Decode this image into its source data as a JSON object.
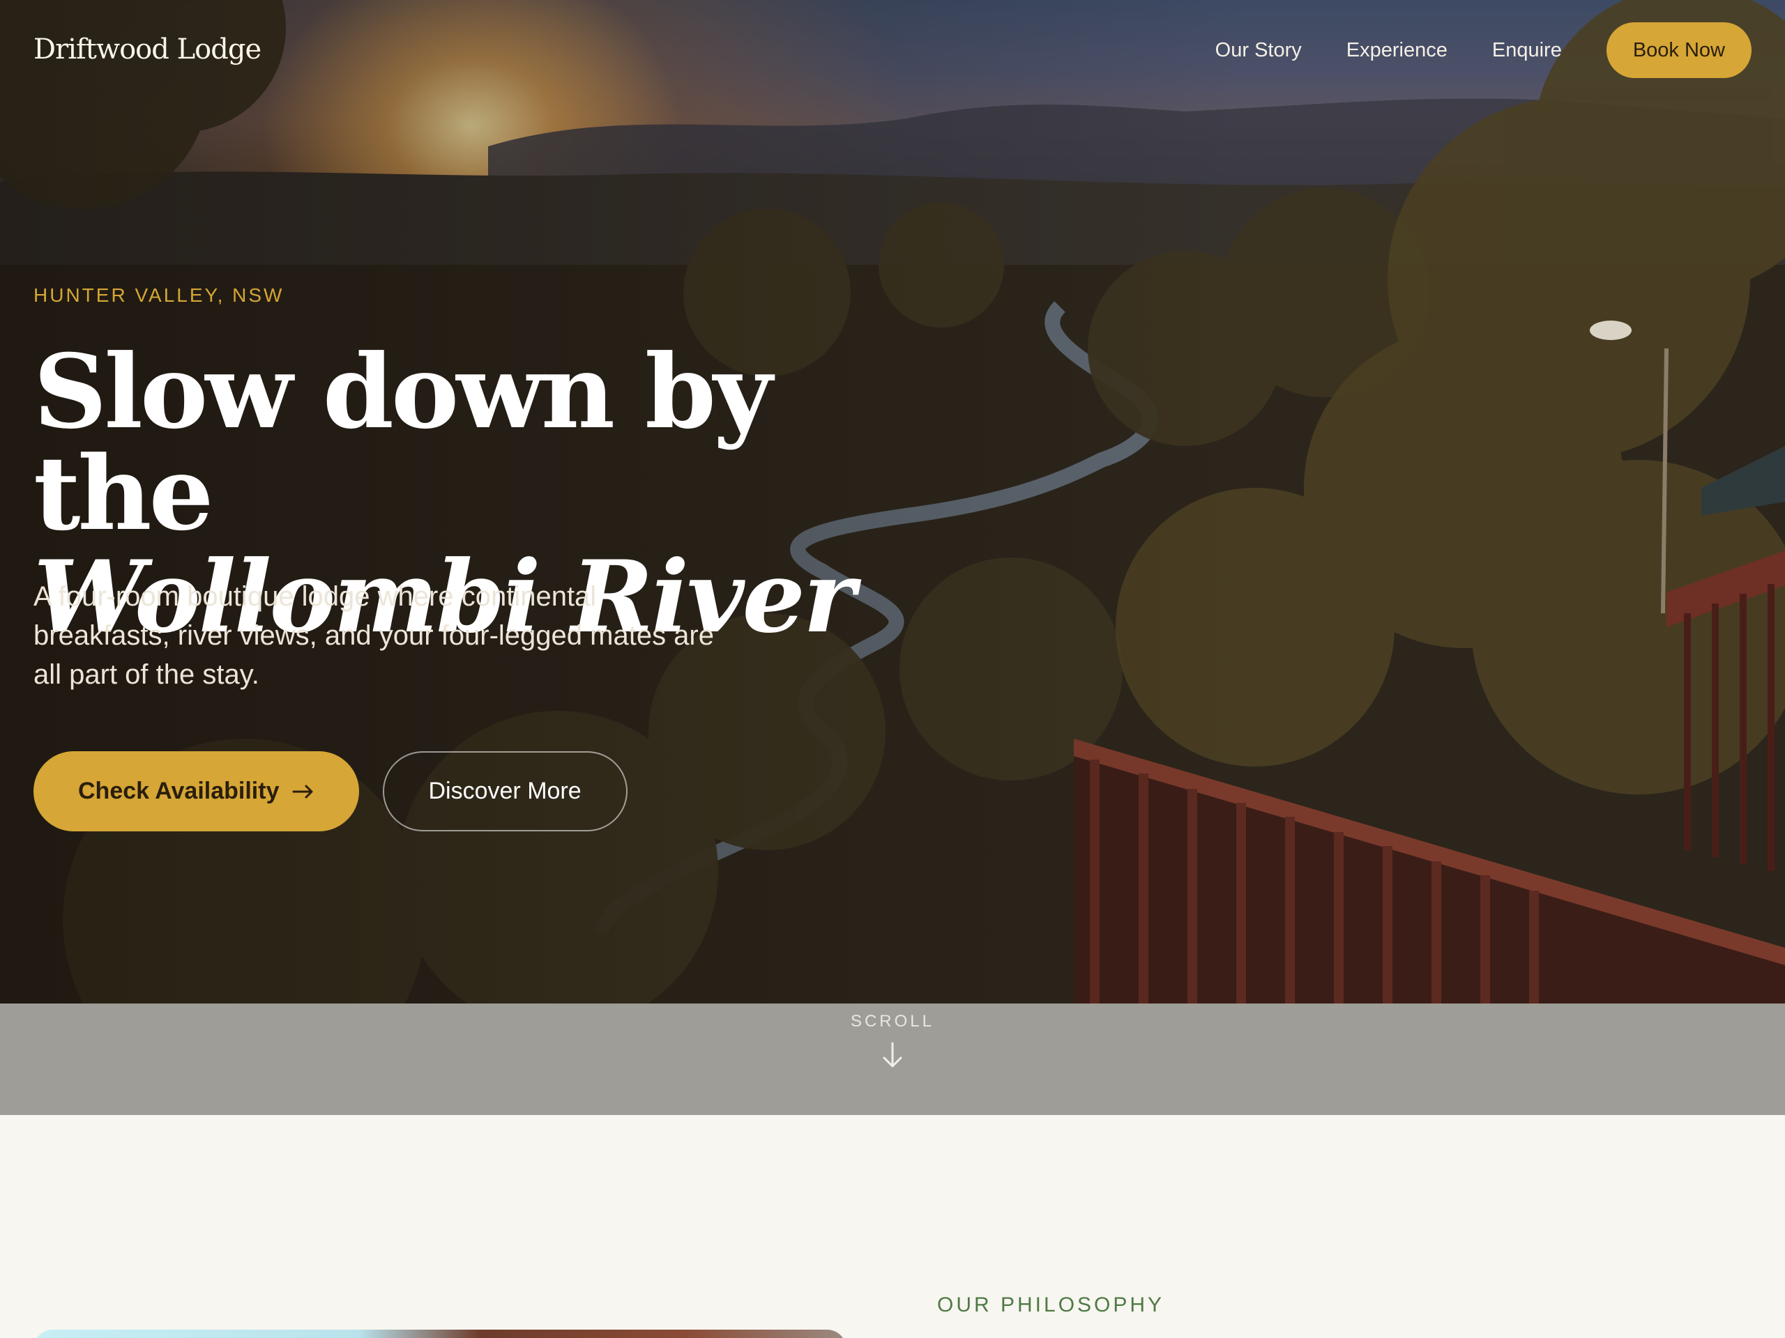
{
  "header": {
    "brand": "Driftwood Lodge",
    "nav": [
      "Our Story",
      "Experience",
      "Enquire"
    ],
    "book_label": "Book Now"
  },
  "hero": {
    "eyebrow": "HUNTER VALLEY, NSW",
    "headline_line1": "Slow down by the",
    "headline_line2": "Wollombi River",
    "lede": "A four-room boutique lodge where continental breakfasts, river views, and your four-legged mates are all part of the stay.",
    "cta_primary": "Check Availability",
    "cta_primary_icon": "arrow-right-icon",
    "cta_secondary": "Discover More"
  },
  "scroll": {
    "label": "SCROLL",
    "icon": "arrow-down-icon"
  },
  "section": {
    "eyebrow": "OUR PHILOSOPHY"
  },
  "colors": {
    "accent": "#d6a636",
    "philosophy_green": "#4f7a45",
    "page_background": "#f8f6f0",
    "scroll_band": "#9f9d97"
  }
}
